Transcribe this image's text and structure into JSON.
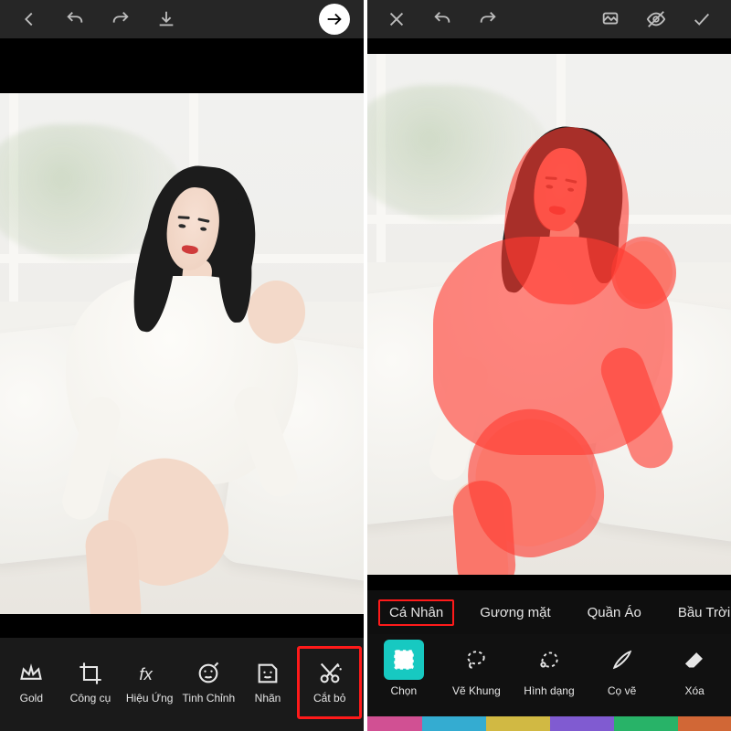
{
  "colors": {
    "highlight": "#ff1a1a",
    "select_tool_bg": "#17c9c1",
    "mask": "rgba(255,60,50,0.62)"
  },
  "left": {
    "topbar": {
      "back": {
        "name": "back-icon"
      },
      "undo": {
        "name": "undo-icon"
      },
      "redo": {
        "name": "redo-icon"
      },
      "save": {
        "name": "download-icon"
      },
      "next": {
        "name": "forward-icon"
      }
    },
    "tools": [
      {
        "key": "gold",
        "label": "Gold",
        "icon": "crown-icon"
      },
      {
        "key": "tools",
        "label": "Công cụ",
        "icon": "crop-icon"
      },
      {
        "key": "fx",
        "label": "Hiệu Ứng",
        "icon": "fx-icon"
      },
      {
        "key": "tune",
        "label": "Tinh Chỉnh",
        "icon": "face-adjust-icon"
      },
      {
        "key": "sticker",
        "label": "Nhãn",
        "icon": "sticker-icon"
      },
      {
        "key": "cutout",
        "label": "Cắt bỏ",
        "icon": "cutout-icon",
        "highlighted": true
      }
    ]
  },
  "right": {
    "topbar": {
      "close": {
        "name": "close-icon"
      },
      "undo": {
        "name": "undo-icon"
      },
      "redo": {
        "name": "redo-icon"
      },
      "preview": {
        "name": "preview-icon"
      },
      "erase": {
        "name": "strike-eye-icon"
      },
      "confirm": {
        "name": "check-icon"
      }
    },
    "chips": [
      {
        "key": "person",
        "label": "Cá Nhân",
        "active": true
      },
      {
        "key": "face",
        "label": "Gương mặt"
      },
      {
        "key": "clothes",
        "label": "Quần Áo"
      },
      {
        "key": "sky",
        "label": "Bầu Trời"
      }
    ],
    "tools": [
      {
        "key": "select",
        "label": "Chọn",
        "icon": "select-person-icon",
        "selected": true
      },
      {
        "key": "outline",
        "label": "Vẽ Khung",
        "icon": "lasso-outline-icon"
      },
      {
        "key": "shape",
        "label": "Hình dạng",
        "icon": "lasso-shape-icon"
      },
      {
        "key": "brush",
        "label": "Cọ vẽ",
        "icon": "brush-icon"
      },
      {
        "key": "erase",
        "label": "Xóa",
        "icon": "eraser-icon"
      }
    ]
  }
}
